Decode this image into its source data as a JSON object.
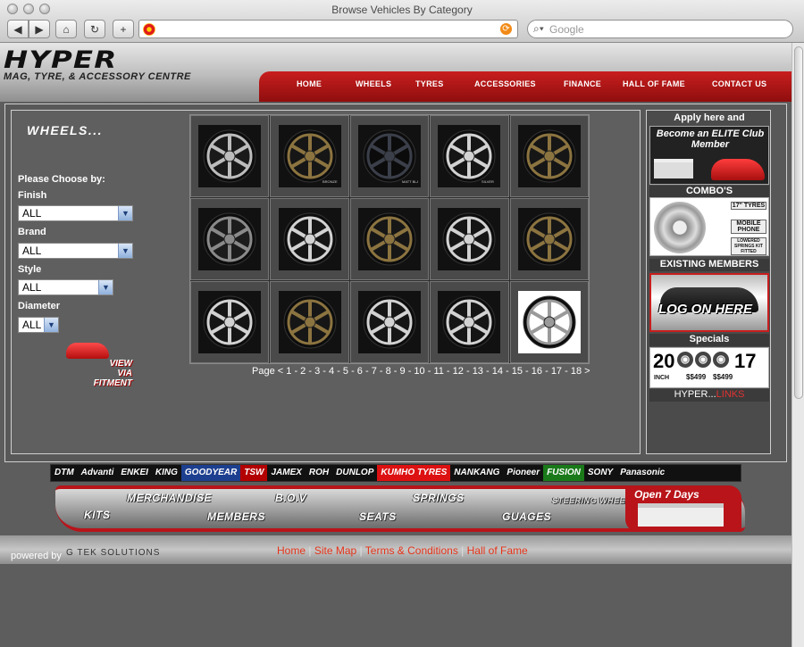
{
  "window": {
    "title": "Browse Vehicles By Category"
  },
  "toolbar": {
    "back": "◀",
    "forward": "▶",
    "home": "⌂",
    "reload": "↻",
    "add": "+",
    "url_value": "",
    "search_placeholder": "Google"
  },
  "site": {
    "logo_main": "HYPER",
    "logo_sub": "MAG, TYRE, & ACCESSORY CENTRE",
    "nav": [
      "HOME",
      "WHEELS",
      "TYRES",
      "ACCESSORIES",
      "FINANCE",
      "HALL OF FAME",
      "CONTACT US"
    ]
  },
  "filters": {
    "section_title": "WHEELS...",
    "heading": "Please Choose by:",
    "finish": {
      "label": "Finish",
      "value": "ALL"
    },
    "brand": {
      "label": "Brand",
      "value": "ALL"
    },
    "style": {
      "label": "Style",
      "value": "ALL"
    },
    "diameter": {
      "label": "Diameter",
      "value": "ALL"
    },
    "fitment_line1": "VIEW",
    "fitment_line2": "VIA FITMENT"
  },
  "grid": {
    "wheels": [
      {
        "style": "dark-silver"
      },
      {
        "style": "bronze"
      },
      {
        "style": "gloss-black"
      },
      {
        "style": "silver"
      },
      {
        "style": "bronze"
      },
      {
        "style": "gunmetal"
      },
      {
        "style": "silver"
      },
      {
        "style": "bronze"
      },
      {
        "style": "silver"
      },
      {
        "style": "bronze"
      },
      {
        "style": "silver"
      },
      {
        "style": "bronze"
      },
      {
        "style": "silver"
      },
      {
        "style": "silver"
      },
      {
        "style": "chrome"
      }
    ],
    "wheel_badges": [
      "",
      "BRONZE",
      "MATT BLACK",
      "SILVER",
      ""
    ]
  },
  "pager": {
    "prefix": "Page",
    "prev": "<",
    "next": ">",
    "pages": [
      "1",
      "2",
      "3",
      "4",
      "5",
      "6",
      "7",
      "8",
      "9",
      "10",
      "11",
      "12",
      "13",
      "14",
      "15",
      "16",
      "17",
      "18"
    ]
  },
  "sidebar": {
    "apply_text": "Apply here and",
    "elite_text": "Become an ELITE Club Member",
    "combos_title": "COMBO'S",
    "combo_tags": [
      "17\" TYRES",
      "MOBILE PHONE",
      "LOWERED SPRINGS KIT FITTED"
    ],
    "existing_title": "EXISTING MEMBERS",
    "login_text": "LOG ON HERE",
    "specials_title": "Specials",
    "specials_left": "20",
    "specials_right": "17",
    "specials_unit": "INCH",
    "specials_prices": [
      "$$499",
      "$$499"
    ],
    "links_prefix": "HYPER...",
    "links_suffix": "LINKS"
  },
  "brands": [
    "DTM",
    "Advanti",
    "ENKEI",
    "KING",
    "GOODYEAR",
    "TSW",
    "JAMEX",
    "ROH",
    "DUNLOP",
    "KUMHO TYRES",
    "NANKANG",
    "Pioneer",
    "FUSION",
    "SONY",
    "Panasonic"
  ],
  "banner": {
    "items": [
      "KITS",
      "MERCHANDISE",
      "MEMBERS",
      "B.O.V",
      "SEATS",
      "SPRINGS",
      "GUAGES",
      "STEERING WHEELS"
    ],
    "open_day": "Open 7 Days"
  },
  "footer": {
    "powered_by": "powered by",
    "powered_brand": "G TEK SOLUTIONS",
    "links": [
      "Home",
      "Site Map",
      "Terms & Conditions",
      "Hall of Fame"
    ],
    "separator": "|"
  },
  "colors": {
    "accent_red": "#c91e1e",
    "link_red": "#e6341a",
    "panel_gray": "#5f5f5f"
  }
}
